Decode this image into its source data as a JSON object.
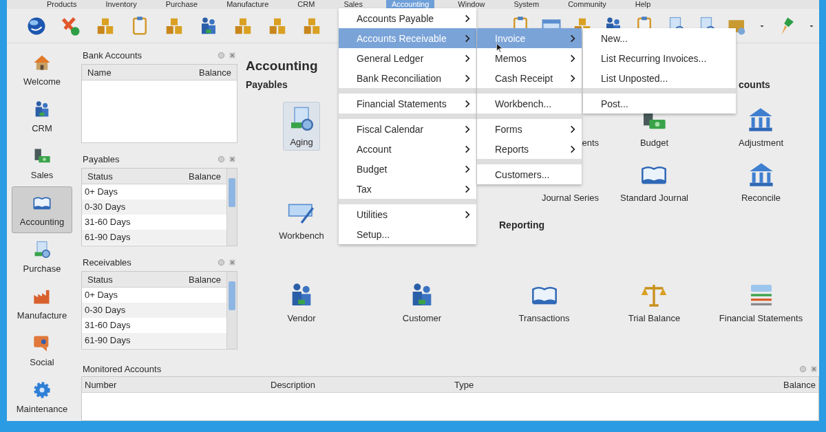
{
  "menubar": [
    {
      "label": "Products",
      "selected": false
    },
    {
      "label": "Inventory",
      "selected": false
    },
    {
      "label": "Purchase",
      "selected": false
    },
    {
      "label": "Manufacture",
      "selected": false
    },
    {
      "label": "CRM",
      "selected": false
    },
    {
      "label": "Sales",
      "selected": false
    },
    {
      "label": "Accounting",
      "selected": true
    },
    {
      "label": "Window",
      "selected": false
    },
    {
      "label": "System",
      "selected": false
    },
    {
      "label": "Community",
      "selected": false
    },
    {
      "label": "Help",
      "selected": false
    }
  ],
  "sidebar": {
    "items": [
      {
        "label": "Welcome",
        "selected": false
      },
      {
        "label": "CRM",
        "selected": false
      },
      {
        "label": "Sales",
        "selected": false
      },
      {
        "label": "Accounting",
        "selected": true
      },
      {
        "label": "Purchase",
        "selected": false
      },
      {
        "label": "Manufacture",
        "selected": false
      },
      {
        "label": "Social",
        "selected": false
      },
      {
        "label": "Maintenance",
        "selected": false
      }
    ]
  },
  "panels": [
    {
      "title": "Bank Accounts",
      "columns": [
        "Name",
        "Balance"
      ]
    },
    {
      "title": "Payables",
      "columns": [
        "Status",
        "Balance"
      ],
      "rows": [
        "0+ Days",
        "0-30 Days",
        "31-60 Days",
        "61-90 Days"
      ]
    },
    {
      "title": "Receivables",
      "columns": [
        "Status",
        "Balance"
      ],
      "rows": [
        "0+ Days",
        "0-30 Days",
        "31-60 Days",
        "61-90 Days"
      ]
    }
  ],
  "main": {
    "title": "Accounting",
    "sections": [
      {
        "heading": "Payables",
        "items": [
          {
            "label": "Aging",
            "selected": true
          },
          {
            "label": "Workbench",
            "selected": false
          },
          {
            "label": "Vendor",
            "selected": false
          },
          {
            "label": "Customer",
            "selected": false
          }
        ]
      },
      {
        "items": [
          {
            "label": "ents",
            "selected": false
          },
          {
            "label": "Budget",
            "selected": false
          },
          {
            "label": "Journal Series",
            "selected": false
          },
          {
            "label": "Standard Journal",
            "selected": false
          }
        ]
      },
      {
        "heading": "counts",
        "items": [
          {
            "label": "Adjustment",
            "selected": false
          },
          {
            "label": "Reconcile",
            "selected": false
          }
        ]
      },
      {
        "heading": "Reporting",
        "items": [
          {
            "label": "Transactions",
            "selected": false
          },
          {
            "label": "Trial Balance",
            "selected": false
          },
          {
            "label": "Financial Statements",
            "selected": false
          }
        ]
      }
    ]
  },
  "monitored_accounts": {
    "title": "Monitored Accounts",
    "columns": [
      "Number",
      "Description",
      "Type",
      "Balance"
    ]
  },
  "menus": [
    {
      "groups": [
        [
          {
            "label": "Accounts Payable",
            "submenu": true,
            "selected": false
          },
          {
            "label": "Accounts Receivable",
            "submenu": true,
            "selected": true
          },
          {
            "label": "General Ledger",
            "submenu": true,
            "selected": false
          },
          {
            "label": "Bank Reconciliation",
            "submenu": true,
            "selected": false
          }
        ],
        [
          {
            "label": "Financial Statements",
            "submenu": true,
            "selected": false
          }
        ],
        [
          {
            "label": "Fiscal Calendar",
            "submenu": true,
            "selected": false
          },
          {
            "label": "Account",
            "submenu": true,
            "selected": false
          },
          {
            "label": "Budget",
            "submenu": true,
            "selected": false
          },
          {
            "label": "Tax",
            "submenu": true,
            "selected": false
          }
        ],
        [
          {
            "label": "Utilities",
            "submenu": true,
            "selected": false
          },
          {
            "label": "Setup...",
            "submenu": false,
            "selected": false
          }
        ]
      ]
    },
    {
      "groups": [
        [
          {
            "label": "Invoice",
            "submenu": true,
            "selected": true
          },
          {
            "label": "Memos",
            "submenu": true,
            "selected": false
          },
          {
            "label": "Cash Receipt",
            "submenu": true,
            "selected": false
          }
        ],
        [
          {
            "label": "Workbench...",
            "submenu": false,
            "selected": false
          }
        ],
        [
          {
            "label": "Forms",
            "submenu": true,
            "selected": false
          },
          {
            "label": "Reports",
            "submenu": true,
            "selected": false
          }
        ],
        [
          {
            "label": "Customers...",
            "submenu": false,
            "selected": false
          }
        ]
      ]
    },
    {
      "groups": [
        [
          {
            "label": "New...",
            "submenu": false,
            "selected": false
          },
          {
            "label": "List Recurring Invoices...",
            "submenu": false,
            "selected": false
          },
          {
            "label": "List Unposted...",
            "submenu": false,
            "selected": false
          }
        ],
        [
          {
            "label": "Post...",
            "submenu": false,
            "selected": false
          }
        ]
      ]
    }
  ]
}
